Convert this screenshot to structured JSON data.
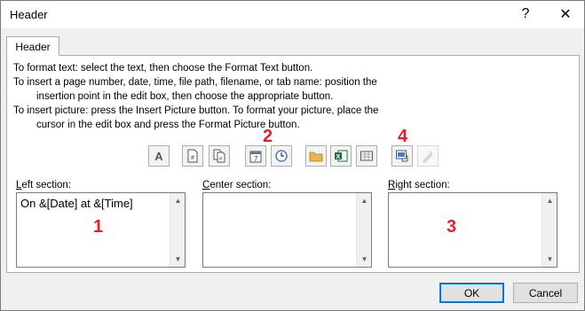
{
  "window": {
    "title": "Header",
    "help_glyph": "?",
    "close_glyph": "✕"
  },
  "tab": {
    "label": "Header"
  },
  "instructions": [
    "To format text:  select the text, then choose the Format Text button.",
    "To insert a page number, date, time, file path, filename, or tab name:  position the",
    "insertion point in the edit box, then choose the appropriate button.",
    "To insert picture: press the Insert Picture button.  To format your picture, place the",
    "cursor in the edit box and press the Format Picture button."
  ],
  "toolbar": {
    "buttons": [
      {
        "name": "format-text-button",
        "icon": "A",
        "enabled": true
      },
      {
        "name": "insert-page-number-button",
        "icon": "page-number-icon",
        "enabled": true
      },
      {
        "name": "insert-number-of-pages-button",
        "icon": "number-of-pages-icon",
        "enabled": true
      },
      {
        "name": "insert-date-button",
        "icon": "calendar-icon",
        "enabled": true
      },
      {
        "name": "insert-time-button",
        "icon": "clock-icon",
        "enabled": true
      },
      {
        "name": "insert-file-path-button",
        "icon": "folder-icon",
        "enabled": true
      },
      {
        "name": "insert-file-name-button",
        "icon": "excel-icon",
        "enabled": true
      },
      {
        "name": "insert-sheet-name-button",
        "icon": "sheet-icon",
        "enabled": true
      },
      {
        "name": "insert-picture-button",
        "icon": "picture-icon",
        "enabled": true
      },
      {
        "name": "format-picture-button",
        "icon": "format-picture-icon",
        "enabled": false
      }
    ]
  },
  "badges": {
    "b1": "1",
    "b2": "2",
    "b3": "3",
    "b4": "4"
  },
  "sections": {
    "left": {
      "label_accel": "L",
      "label_rest": "eft section:",
      "value": "On &[Date] at &[Time]"
    },
    "center": {
      "label_accel": "C",
      "label_rest": "enter section:",
      "value": ""
    },
    "right": {
      "label_accel": "R",
      "label_rest": "ight section:",
      "value": ""
    }
  },
  "footer": {
    "ok_label": "OK",
    "cancel_label": "Cancel"
  },
  "colors": {
    "badge": "#e0202a",
    "accent": "#0078d7"
  }
}
